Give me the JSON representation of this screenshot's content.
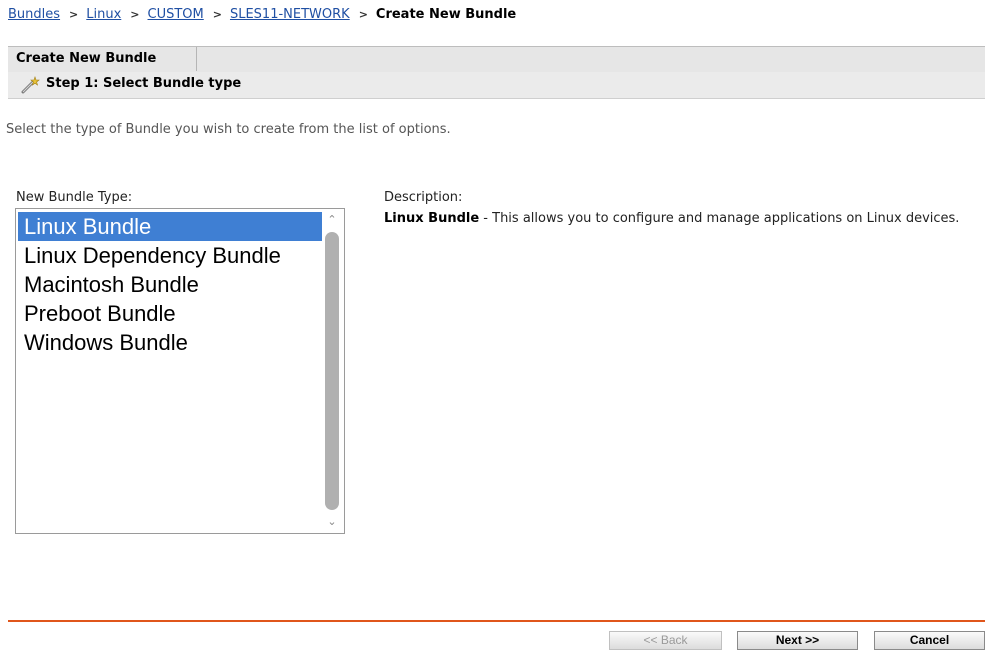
{
  "breadcrumb": {
    "items": [
      "Bundles",
      "Linux",
      "CUSTOM",
      "SLES11-NETWORK"
    ],
    "current": "Create New Bundle",
    "separator": ">"
  },
  "tab": {
    "label": "Create New Bundle"
  },
  "step": {
    "label": "Step 1: Select Bundle type",
    "icon": "wizard-wand-icon"
  },
  "intro": "Select the type of Bundle you wish to create from the list of options.",
  "bundle_type": {
    "label": "New Bundle Type:",
    "options": [
      "Linux Bundle",
      "Linux Dependency Bundle",
      "Macintosh Bundle",
      "Preboot Bundle",
      "Windows Bundle"
    ],
    "selected": "Linux Bundle"
  },
  "description": {
    "label": "Description:",
    "title": "Linux Bundle",
    "text": " - This allows you to configure and manage applications on Linux devices."
  },
  "buttons": {
    "back": "<< Back",
    "next": "Next >>",
    "cancel": "Cancel"
  },
  "colors": {
    "accent_rule": "#e0561b",
    "selection": "#3f7fd3",
    "link": "#1f4fa3"
  }
}
